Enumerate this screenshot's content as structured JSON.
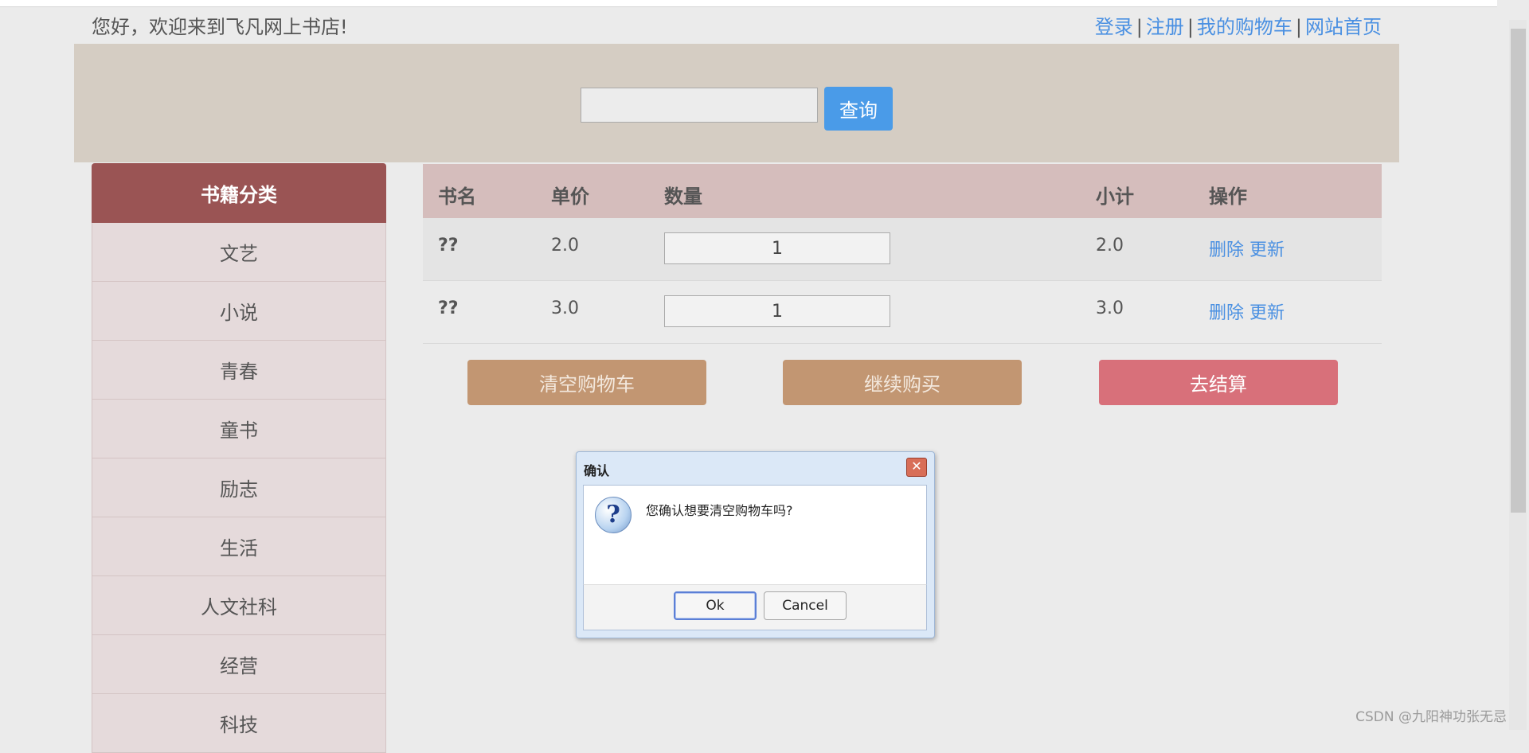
{
  "header": {
    "welcome": "您好，欢迎来到飞凡网上书店!",
    "links": [
      "登录",
      "注册",
      "我的购物车",
      "网站首页"
    ],
    "separator": "|"
  },
  "search": {
    "value": "",
    "placeholder": "",
    "button": "查询"
  },
  "sidebar": {
    "title": "书籍分类",
    "items": [
      "文艺",
      "小说",
      "青春",
      "童书",
      "励志",
      "生活",
      "人文社科",
      "经营",
      "科技"
    ]
  },
  "cart": {
    "columns": [
      "书名",
      "单价",
      "数量",
      "小计",
      "操作"
    ],
    "rows": [
      {
        "name": "??",
        "price": "2.0",
        "qty": "1",
        "subtotal": "2.0",
        "delete": "删除",
        "update": "更新"
      },
      {
        "name": "??",
        "price": "3.0",
        "qty": "1",
        "subtotal": "3.0",
        "delete": "删除",
        "update": "更新"
      }
    ],
    "buttons": {
      "clear": "清空购物车",
      "continue": "继续购买",
      "checkout": "去结算"
    }
  },
  "dialog": {
    "title": "确认",
    "close": "✕",
    "icon": "question-icon",
    "message": "您确认想要清空购物车吗?",
    "ok": "Ok",
    "cancel": "Cancel"
  },
  "watermark": "CSDN @九阳神功张无忌"
}
